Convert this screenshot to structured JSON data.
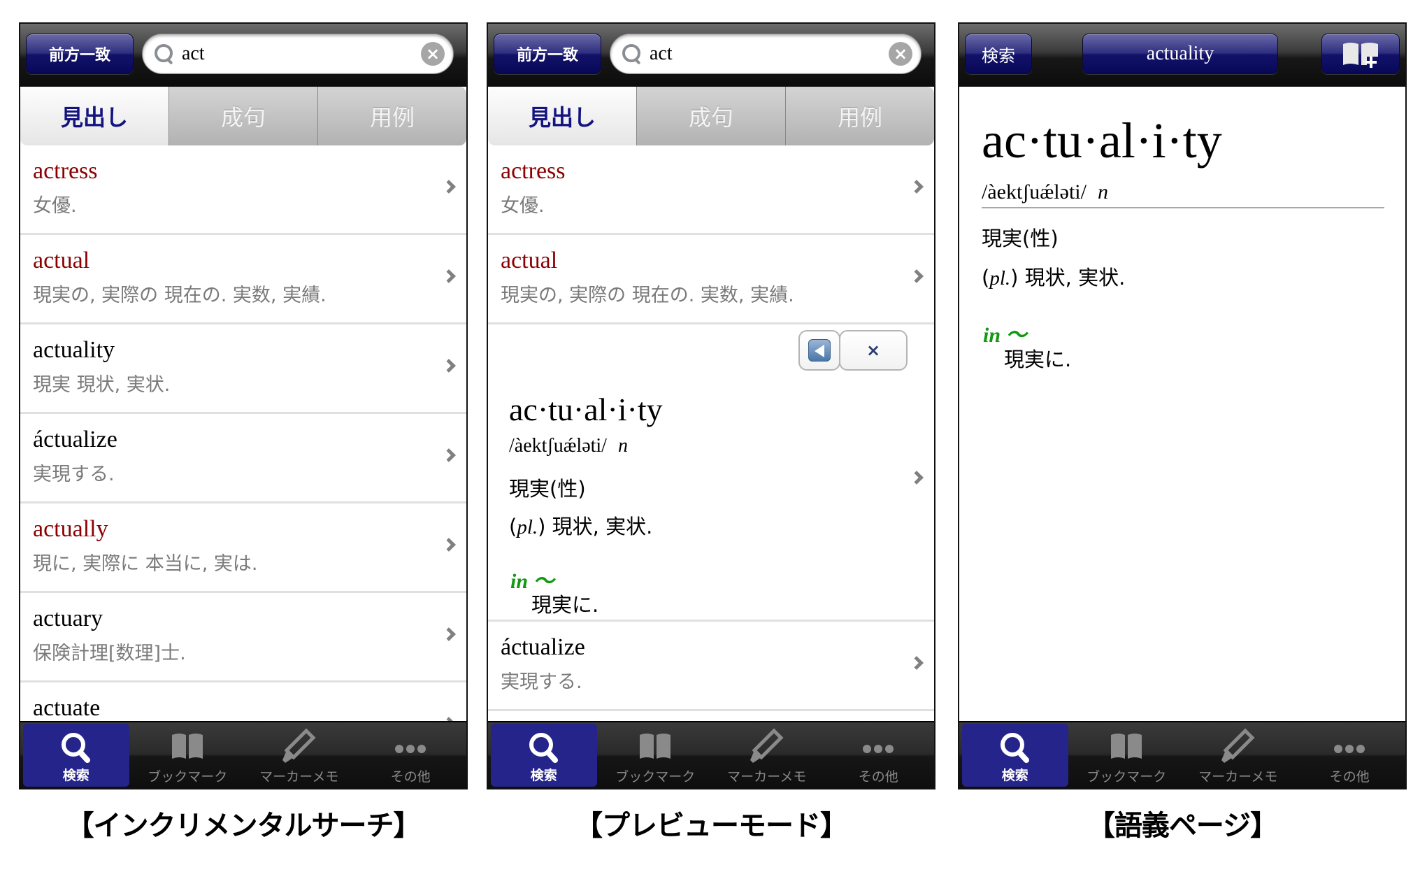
{
  "search_header": {
    "mode_button": "前方一致",
    "search_value": "act",
    "clear_icon": "×",
    "segments": [
      "見出し",
      "成句",
      "用例"
    ],
    "active_segment": 0
  },
  "incremental": {
    "rows": [
      {
        "headword": "actress",
        "translation": "女優.",
        "highlight": true
      },
      {
        "headword": "actual",
        "translation": "現実の, 実際の 現在の. 実数, 実績.",
        "highlight": true
      },
      {
        "headword": "actuality",
        "translation": "現実 現状, 実状.",
        "highlight": false
      },
      {
        "headword": "áctualize",
        "translation": "実現する.",
        "highlight": false
      },
      {
        "headword": "actually",
        "translation": "現に, 実際に 本当に, 実は.",
        "highlight": true
      },
      {
        "headword": "actuary",
        "translation": "保険計理[数理]士.",
        "highlight": false
      },
      {
        "headword": "actuate",
        "translation": "",
        "highlight": false
      }
    ]
  },
  "preview": {
    "rows_before": [
      {
        "headword": "actress",
        "translation": "女優.",
        "highlight": true
      },
      {
        "headword": "actual",
        "translation": "現実の, 実際の 現在の. 実数, 実績.",
        "highlight": true
      }
    ],
    "close_label": "×",
    "rows_after": [
      {
        "headword": "áctualize",
        "translation": "実現する.",
        "highlight": false
      }
    ]
  },
  "entry": {
    "headword": "ac·tu·al·i·ty",
    "pronunciation": "/àektʃuǽləti/",
    "pos": "n",
    "sense1": "現実(性)",
    "sense2_label": "pl.",
    "sense2_text": " 現状, 実状.",
    "idiom": "in 〜",
    "idiom_translation": "現実に."
  },
  "detail_header": {
    "back_label": "検索",
    "title": "actuality",
    "bookmark_add_icon": "book-plus"
  },
  "tabbar": [
    {
      "label": "検索",
      "icon": "search-icon",
      "active": true
    },
    {
      "label": "ブックマーク",
      "icon": "book-icon",
      "active": false
    },
    {
      "label": "マーカーメモ",
      "icon": "pen-icon",
      "active": false
    },
    {
      "label": "その他",
      "icon": "more-icon",
      "active": false
    }
  ],
  "captions": [
    "【インクリメンタルサーチ】",
    "【プレビューモード】",
    "【語義ページ】"
  ],
  "colors": {
    "highlight_headword": "#8b0000",
    "idiom": "#119911",
    "accent_navy": "#24248a"
  }
}
